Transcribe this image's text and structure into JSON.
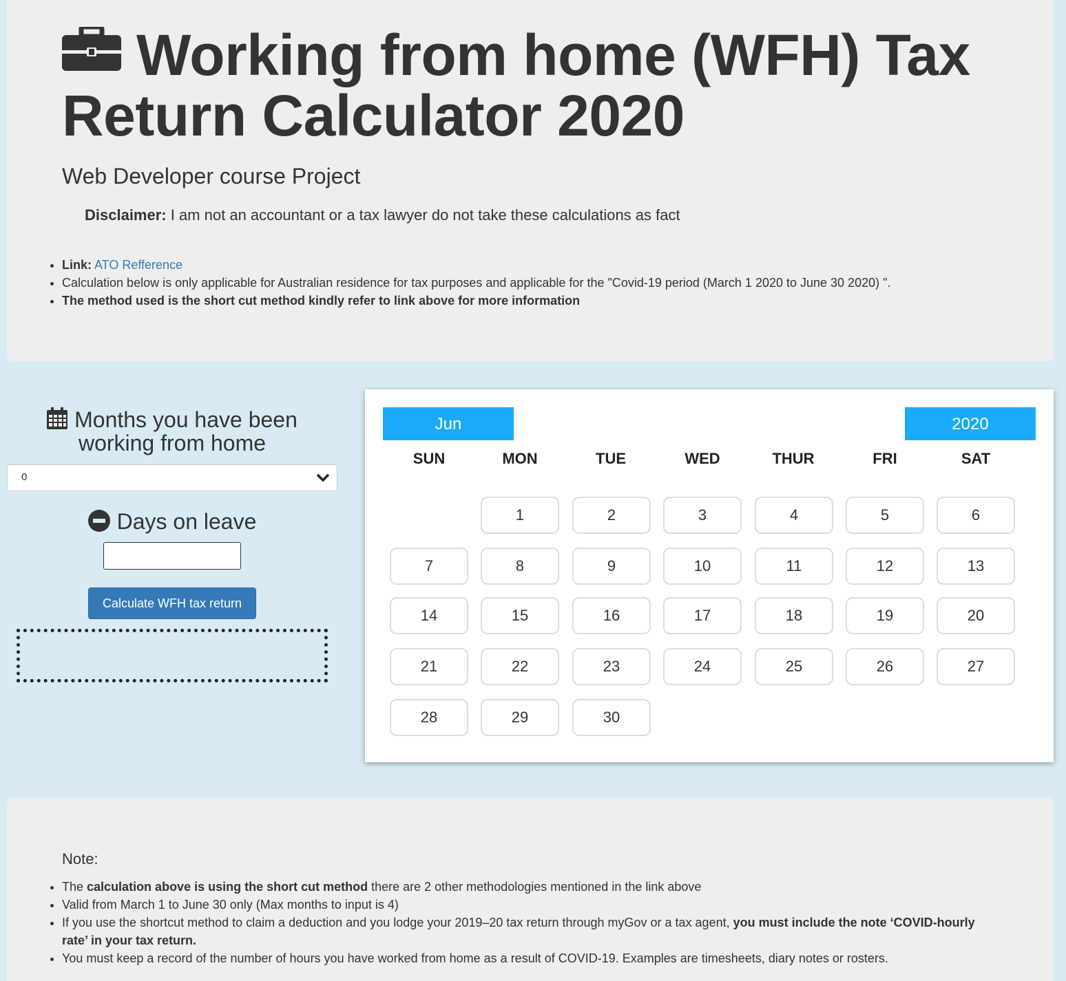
{
  "header": {
    "title": "Working from home (WFH) Tax Return Calculator 2020",
    "title_icon": "briefcase-icon",
    "subtitle": "Web Developer course Project",
    "disclaimer_label": "Disclaimer:",
    "disclaimer_text": " I am not an accountant or a tax lawyer do not take these calculations as fact",
    "info": {
      "link_label": "Link:",
      "link_text": "ATO Refference",
      "line2": "Calculation below is only applicable for Australian residence for tax purposes and applicable for the \"Covid-19 period (March 1 2020 to June 30 2020) \".",
      "line3": "The method used is the short cut method kindly refer to link above for more information"
    }
  },
  "form": {
    "months_heading": "Months you have been working from home",
    "months_icon": "calendar-icon",
    "months_value": "0",
    "leave_heading": "Days on leave",
    "leave_icon": "minus-circle-icon",
    "leave_value": "",
    "calculate_label": "Calculate WFH tax return"
  },
  "calendar": {
    "month": "Jun",
    "year": "2020",
    "accent": "#1aaaf8",
    "weekdays": [
      "SUN",
      "MON",
      "TUE",
      "WED",
      "THUR",
      "FRI",
      "SAT"
    ],
    "days": [
      "1",
      "2",
      "3",
      "4",
      "5",
      "6",
      "7",
      "8",
      "9",
      "10",
      "11",
      "12",
      "13",
      "14",
      "15",
      "16",
      "17",
      "18",
      "19",
      "20",
      "21",
      "22",
      "23",
      "24",
      "25",
      "26",
      "27",
      "28",
      "29",
      "30"
    ]
  },
  "note": {
    "heading": "Note:",
    "item1_pre": "The ",
    "item1_bold": "calculation above is using the short cut method",
    "item1_post": " there are 2 other methodologies mentioned in the link above",
    "item2": "Valid from March 1 to June 30 only (Max months to input is 4)",
    "item3_pre": "If you use the shortcut method to claim a deduction and you lodge your 2019–20 tax return through myGov or a tax agent, ",
    "item3_bold": "you must include the note ‘COVID-hourly rate’ in your tax return.",
    "item4": "You must keep a record of the number of hours you have worked from home as a result of COVID-19. Examples are timesheets, diary notes or rosters."
  }
}
